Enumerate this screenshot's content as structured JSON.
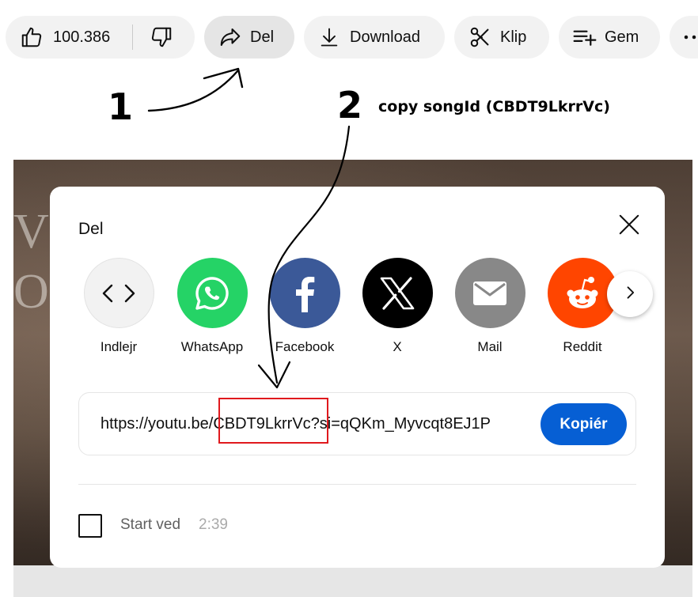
{
  "actions": {
    "like_count": "100.386",
    "share_label": "Del",
    "download_label": "Download",
    "clip_label": "Klip",
    "save_label": "Gem",
    "more_icon": "more-horizontal-icon"
  },
  "annotation": {
    "step1": "1",
    "step2": "2",
    "note": "copy songId (CBDT9LkrrVc)"
  },
  "dialog": {
    "title": "Del",
    "share_targets": [
      {
        "label": "Indlejr",
        "icon": "embed-icon",
        "color": "#f2f2f2"
      },
      {
        "label": "WhatsApp",
        "icon": "whatsapp-icon",
        "color": "#25d366"
      },
      {
        "label": "Facebook",
        "icon": "facebook-icon",
        "color": "#3b5998"
      },
      {
        "label": "X",
        "icon": "x-icon",
        "color": "#000000"
      },
      {
        "label": "Mail",
        "icon": "mail-icon",
        "color": "#888888"
      },
      {
        "label": "Reddit",
        "icon": "reddit-icon",
        "color": "#ff4500"
      }
    ],
    "link": {
      "prefix": "https://youtu.be/",
      "song_id": "CBDT9LkrrVc",
      "suffix": "?si=qQKm_Myvcqt8EJ1P"
    },
    "copy_label": "Kopiér",
    "start_at": {
      "label": "Start ved",
      "time": "2:39",
      "checked": false
    }
  },
  "colors": {
    "accent": "#065fd4",
    "highlight": "#e0191d"
  }
}
